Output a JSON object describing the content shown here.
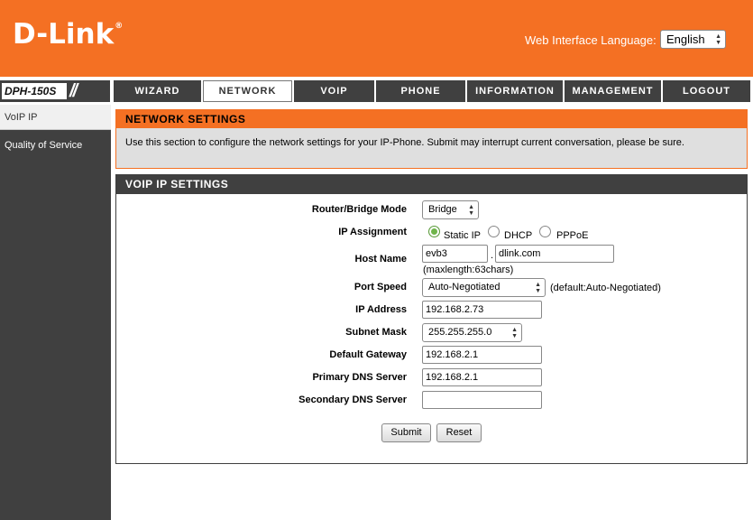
{
  "header": {
    "logo_text": "D-Link",
    "logo_mark": "®",
    "language_label": "Web Interface Language:",
    "language_value": "English"
  },
  "model": "DPH-150S",
  "nav": {
    "tabs": [
      {
        "label": "WIZARD",
        "active": false
      },
      {
        "label": "NETWORK",
        "active": true
      },
      {
        "label": "VOIP",
        "active": false
      },
      {
        "label": "PHONE",
        "active": false
      },
      {
        "label": "INFORMATION",
        "active": false
      },
      {
        "label": "MANAGEMENT",
        "active": false
      },
      {
        "label": "LOGOUT",
        "active": false
      }
    ]
  },
  "sidebar": {
    "items": [
      {
        "label": "VoIP IP",
        "active": true
      },
      {
        "label": "Quality of Service",
        "active": false
      }
    ]
  },
  "network_settings": {
    "title": "NETWORK SETTINGS",
    "description": "Use this section to configure the network settings for your IP-Phone. Submit may interrupt current conversation, please be sure."
  },
  "voip_ip": {
    "title": "VOIP IP SETTINGS",
    "router_bridge_mode": {
      "label": "Router/Bridge Mode",
      "value": "Bridge"
    },
    "ip_assignment": {
      "label": "IP Assignment",
      "options": [
        "Static IP",
        "DHCP",
        "PPPoE"
      ],
      "selected": "Static IP"
    },
    "host_name": {
      "label": "Host Name",
      "host": "evb3",
      "separator": ".",
      "domain": "dlink.com",
      "note": "(maxlength:63chars)"
    },
    "port_speed": {
      "label": "Port Speed",
      "value": "Auto-Negotiated",
      "note": "(default:Auto-Negotiated)"
    },
    "ip_address": {
      "label": "IP Address",
      "value": "192.168.2.73"
    },
    "subnet_mask": {
      "label": "Subnet Mask",
      "value": "255.255.255.0"
    },
    "default_gateway": {
      "label": "Default Gateway",
      "value": "192.168.2.1"
    },
    "primary_dns": {
      "label": "Primary DNS Server",
      "value": "192.168.2.1"
    },
    "secondary_dns": {
      "label": "Secondary DNS Server",
      "value": ""
    },
    "submit_label": "Submit",
    "reset_label": "Reset"
  },
  "colors": {
    "brand_orange": "#f47023",
    "dark_gray": "#404040"
  },
  "icons": {
    "select_arrows": "up-down-arrows-icon",
    "radio": "radio-icon"
  }
}
